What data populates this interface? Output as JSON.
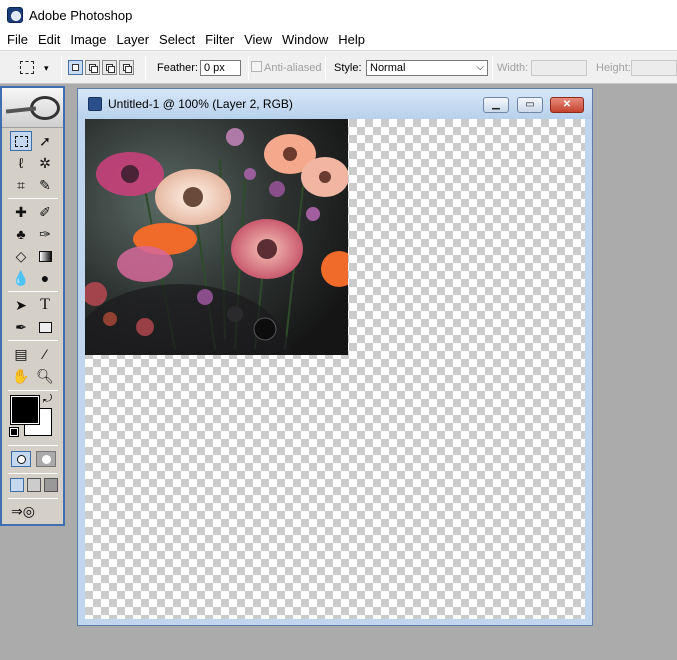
{
  "app": {
    "title": "Adobe Photoshop"
  },
  "menu": [
    "File",
    "Edit",
    "Image",
    "Layer",
    "Select",
    "Filter",
    "View",
    "Window",
    "Help"
  ],
  "options": {
    "feather_label": "Feather:",
    "feather_value": "0 px",
    "antialias_label": "Anti-aliased",
    "style_label": "Style:",
    "style_value": "Normal",
    "width_label": "Width:",
    "height_label": "Height:"
  },
  "document": {
    "title": "Untitled-1 @ 100% (Layer 2, RGB)"
  },
  "colors": {
    "foreground": "#000000",
    "background": "#ffffff",
    "window_frame": "#bfd6ee"
  },
  "icons": {
    "tools": [
      "marquee-icon",
      "move-icon",
      "lasso-icon",
      "magic-wand-icon",
      "crop-icon",
      "slice-icon",
      "healing-brush-icon",
      "brush-icon",
      "clone-stamp-icon",
      "history-brush-icon",
      "eraser-icon",
      "gradient-icon",
      "blur-icon",
      "dodge-icon",
      "path-selection-icon",
      "type-icon",
      "pen-icon",
      "shape-icon",
      "notes-icon",
      "eyedropper-icon",
      "hand-icon",
      "zoom-icon"
    ]
  }
}
